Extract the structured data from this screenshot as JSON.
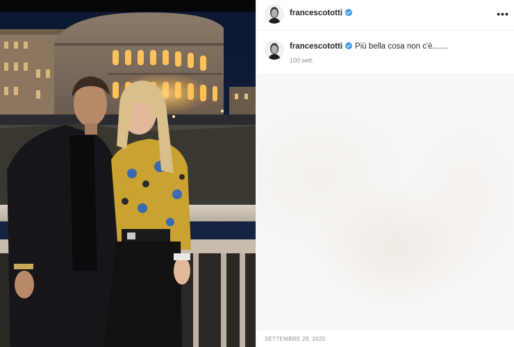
{
  "post": {
    "username": "francescototti",
    "verified": true,
    "caption": "Più bella cosa non c'è.......",
    "time_ago": "100 sett.",
    "date": "SETTEMBRE 29, 2020"
  },
  "header": {
    "username": "francescototti",
    "more_icon": "more-options-icon"
  },
  "colors": {
    "verified_badge": "#3897f0",
    "text_primary": "#262626",
    "text_secondary": "#8e8e8e"
  }
}
